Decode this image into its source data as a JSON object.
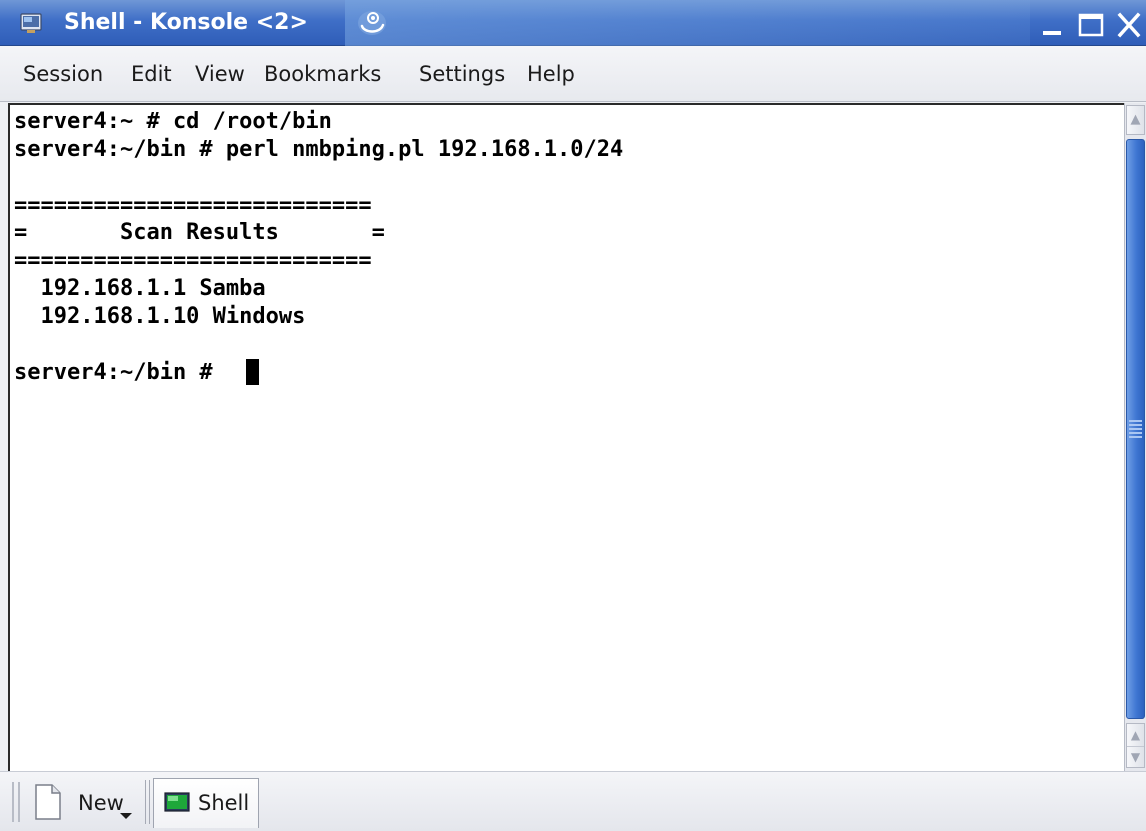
{
  "window": {
    "title": "Shell - Konsole <2>",
    "accent_color": "#3f6fc7",
    "icons": {
      "app": "konsole-app-icon",
      "logo": "suse-chameleon-logo-icon",
      "minimize": "minimize-icon",
      "maximize": "maximize-icon",
      "close": "close-icon"
    }
  },
  "menubar": {
    "items": [
      {
        "label": "Session"
      },
      {
        "label": "Edit"
      },
      {
        "label": "View"
      },
      {
        "label": "Bookmarks"
      },
      {
        "label": "Settings"
      },
      {
        "label": "Help"
      }
    ]
  },
  "terminal": {
    "lines": [
      "server4:~ # cd /root/bin",
      "server4:~/bin # perl nmbping.pl 192.168.1.0/24",
      "",
      "===========================",
      "=       Scan Results       =",
      "===========================",
      "  192.168.1.1 Samba",
      "  192.168.1.10 Windows",
      "",
      "server4:~/bin # "
    ]
  },
  "tabbar": {
    "new_label": "New",
    "tabs": [
      {
        "label": "Shell",
        "icon": "terminal-icon",
        "active": true
      }
    ]
  }
}
